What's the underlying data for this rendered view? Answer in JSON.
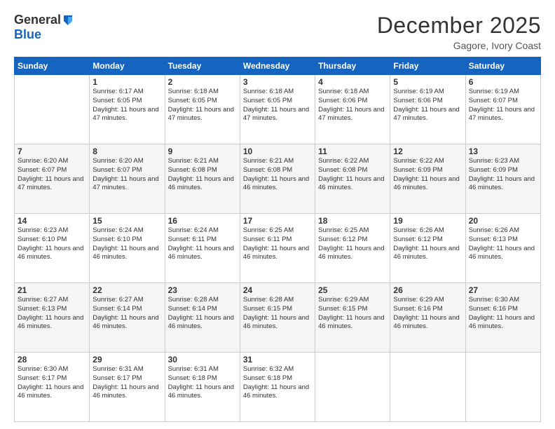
{
  "logo": {
    "general": "General",
    "blue": "Blue"
  },
  "title": "December 2025",
  "location": "Gagore, Ivory Coast",
  "days_of_week": [
    "Sunday",
    "Monday",
    "Tuesday",
    "Wednesday",
    "Thursday",
    "Friday",
    "Saturday"
  ],
  "weeks": [
    [
      {
        "num": "",
        "sunrise": "",
        "sunset": "",
        "daylight": ""
      },
      {
        "num": "1",
        "sunrise": "Sunrise: 6:17 AM",
        "sunset": "Sunset: 6:05 PM",
        "daylight": "Daylight: 11 hours and 47 minutes."
      },
      {
        "num": "2",
        "sunrise": "Sunrise: 6:18 AM",
        "sunset": "Sunset: 6:05 PM",
        "daylight": "Daylight: 11 hours and 47 minutes."
      },
      {
        "num": "3",
        "sunrise": "Sunrise: 6:18 AM",
        "sunset": "Sunset: 6:05 PM",
        "daylight": "Daylight: 11 hours and 47 minutes."
      },
      {
        "num": "4",
        "sunrise": "Sunrise: 6:18 AM",
        "sunset": "Sunset: 6:06 PM",
        "daylight": "Daylight: 11 hours and 47 minutes."
      },
      {
        "num": "5",
        "sunrise": "Sunrise: 6:19 AM",
        "sunset": "Sunset: 6:06 PM",
        "daylight": "Daylight: 11 hours and 47 minutes."
      },
      {
        "num": "6",
        "sunrise": "Sunrise: 6:19 AM",
        "sunset": "Sunset: 6:07 PM",
        "daylight": "Daylight: 11 hours and 47 minutes."
      }
    ],
    [
      {
        "num": "7",
        "sunrise": "Sunrise: 6:20 AM",
        "sunset": "Sunset: 6:07 PM",
        "daylight": "Daylight: 11 hours and 47 minutes."
      },
      {
        "num": "8",
        "sunrise": "Sunrise: 6:20 AM",
        "sunset": "Sunset: 6:07 PM",
        "daylight": "Daylight: 11 hours and 47 minutes."
      },
      {
        "num": "9",
        "sunrise": "Sunrise: 6:21 AM",
        "sunset": "Sunset: 6:08 PM",
        "daylight": "Daylight: 11 hours and 46 minutes."
      },
      {
        "num": "10",
        "sunrise": "Sunrise: 6:21 AM",
        "sunset": "Sunset: 6:08 PM",
        "daylight": "Daylight: 11 hours and 46 minutes."
      },
      {
        "num": "11",
        "sunrise": "Sunrise: 6:22 AM",
        "sunset": "Sunset: 6:08 PM",
        "daylight": "Daylight: 11 hours and 46 minutes."
      },
      {
        "num": "12",
        "sunrise": "Sunrise: 6:22 AM",
        "sunset": "Sunset: 6:09 PM",
        "daylight": "Daylight: 11 hours and 46 minutes."
      },
      {
        "num": "13",
        "sunrise": "Sunrise: 6:23 AM",
        "sunset": "Sunset: 6:09 PM",
        "daylight": "Daylight: 11 hours and 46 minutes."
      }
    ],
    [
      {
        "num": "14",
        "sunrise": "Sunrise: 6:23 AM",
        "sunset": "Sunset: 6:10 PM",
        "daylight": "Daylight: 11 hours and 46 minutes."
      },
      {
        "num": "15",
        "sunrise": "Sunrise: 6:24 AM",
        "sunset": "Sunset: 6:10 PM",
        "daylight": "Daylight: 11 hours and 46 minutes."
      },
      {
        "num": "16",
        "sunrise": "Sunrise: 6:24 AM",
        "sunset": "Sunset: 6:11 PM",
        "daylight": "Daylight: 11 hours and 46 minutes."
      },
      {
        "num": "17",
        "sunrise": "Sunrise: 6:25 AM",
        "sunset": "Sunset: 6:11 PM",
        "daylight": "Daylight: 11 hours and 46 minutes."
      },
      {
        "num": "18",
        "sunrise": "Sunrise: 6:25 AM",
        "sunset": "Sunset: 6:12 PM",
        "daylight": "Daylight: 11 hours and 46 minutes."
      },
      {
        "num": "19",
        "sunrise": "Sunrise: 6:26 AM",
        "sunset": "Sunset: 6:12 PM",
        "daylight": "Daylight: 11 hours and 46 minutes."
      },
      {
        "num": "20",
        "sunrise": "Sunrise: 6:26 AM",
        "sunset": "Sunset: 6:13 PM",
        "daylight": "Daylight: 11 hours and 46 minutes."
      }
    ],
    [
      {
        "num": "21",
        "sunrise": "Sunrise: 6:27 AM",
        "sunset": "Sunset: 6:13 PM",
        "daylight": "Daylight: 11 hours and 46 minutes."
      },
      {
        "num": "22",
        "sunrise": "Sunrise: 6:27 AM",
        "sunset": "Sunset: 6:14 PM",
        "daylight": "Daylight: 11 hours and 46 minutes."
      },
      {
        "num": "23",
        "sunrise": "Sunrise: 6:28 AM",
        "sunset": "Sunset: 6:14 PM",
        "daylight": "Daylight: 11 hours and 46 minutes."
      },
      {
        "num": "24",
        "sunrise": "Sunrise: 6:28 AM",
        "sunset": "Sunset: 6:15 PM",
        "daylight": "Daylight: 11 hours and 46 minutes."
      },
      {
        "num": "25",
        "sunrise": "Sunrise: 6:29 AM",
        "sunset": "Sunset: 6:15 PM",
        "daylight": "Daylight: 11 hours and 46 minutes."
      },
      {
        "num": "26",
        "sunrise": "Sunrise: 6:29 AM",
        "sunset": "Sunset: 6:16 PM",
        "daylight": "Daylight: 11 hours and 46 minutes."
      },
      {
        "num": "27",
        "sunrise": "Sunrise: 6:30 AM",
        "sunset": "Sunset: 6:16 PM",
        "daylight": "Daylight: 11 hours and 46 minutes."
      }
    ],
    [
      {
        "num": "28",
        "sunrise": "Sunrise: 6:30 AM",
        "sunset": "Sunset: 6:17 PM",
        "daylight": "Daylight: 11 hours and 46 minutes."
      },
      {
        "num": "29",
        "sunrise": "Sunrise: 6:31 AM",
        "sunset": "Sunset: 6:17 PM",
        "daylight": "Daylight: 11 hours and 46 minutes."
      },
      {
        "num": "30",
        "sunrise": "Sunrise: 6:31 AM",
        "sunset": "Sunset: 6:18 PM",
        "daylight": "Daylight: 11 hours and 46 minutes."
      },
      {
        "num": "31",
        "sunrise": "Sunrise: 6:32 AM",
        "sunset": "Sunset: 6:18 PM",
        "daylight": "Daylight: 11 hours and 46 minutes."
      },
      {
        "num": "",
        "sunrise": "",
        "sunset": "",
        "daylight": ""
      },
      {
        "num": "",
        "sunrise": "",
        "sunset": "",
        "daylight": ""
      },
      {
        "num": "",
        "sunrise": "",
        "sunset": "",
        "daylight": ""
      }
    ]
  ]
}
